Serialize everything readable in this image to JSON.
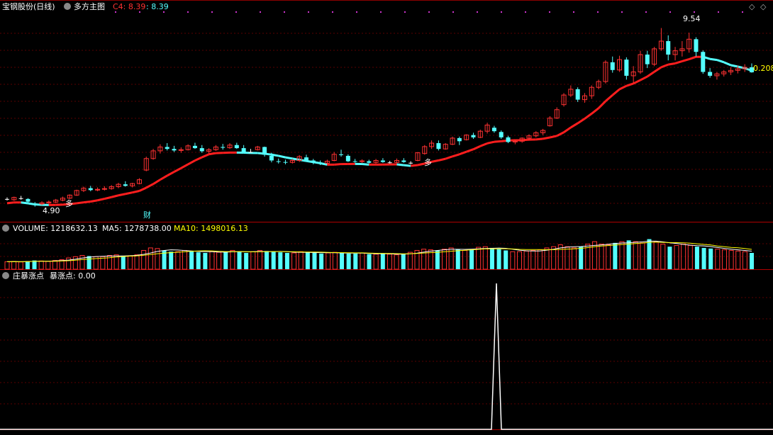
{
  "header": {
    "stock_title": "宝钢股份(日线)",
    "indicator_name": "多方主图",
    "c4_label": "C4: 8.39",
    "c4_value": ": 8.39"
  },
  "volume_panel": {
    "label": "VOLUME: 1218632.13",
    "ma5_label": "MA5: 1278738.00",
    "ma10_label": "MA10: 1498016.13"
  },
  "bottom_panel": {
    "label": "庄暴涨点",
    "value_label": "暴涨点: 0.00"
  },
  "annotations": {
    "high_price": "9.54",
    "low_price": "4.90",
    "current_value": "0.208",
    "duo_marker": "多",
    "cai_marker": "财"
  },
  "colors": {
    "up": "#ff3232",
    "down": "#54ffff",
    "flat": "#ffffff",
    "ma_red": "#ff1e1e",
    "ma_cyan": "#54ffff",
    "ma5": "#ffffff",
    "ma10": "#ffff00",
    "grid": "#8b0000"
  },
  "chart_data": [
    {
      "type": "candlestick",
      "title": "宝钢股份(日线)",
      "yrange": [
        4.6,
        9.9
      ],
      "annotations": [
        {
          "text": "9.54",
          "value": 9.54
        },
        {
          "text": "4.90",
          "value": 4.9
        }
      ],
      "ohlc": [
        [
          5.1,
          5.14,
          5.06,
          5.1
        ],
        [
          5.08,
          5.16,
          5.05,
          5.14
        ],
        [
          5.12,
          5.18,
          5.08,
          5.12
        ],
        [
          5.1,
          5.12,
          5.0,
          5.03
        ],
        [
          4.98,
          5.02,
          4.9,
          4.96
        ],
        [
          4.97,
          5.04,
          4.94,
          5.0
        ],
        [
          5.0,
          5.06,
          4.96,
          5.02
        ],
        [
          5.02,
          5.1,
          4.99,
          5.07
        ],
        [
          5.07,
          5.16,
          5.04,
          5.12
        ],
        [
          5.12,
          5.22,
          5.1,
          5.2
        ],
        [
          5.2,
          5.34,
          5.18,
          5.32
        ],
        [
          5.32,
          5.42,
          5.28,
          5.38
        ],
        [
          5.38,
          5.44,
          5.3,
          5.33
        ],
        [
          5.33,
          5.4,
          5.3,
          5.35
        ],
        [
          5.35,
          5.43,
          5.32,
          5.37
        ],
        [
          5.37,
          5.46,
          5.34,
          5.42
        ],
        [
          5.42,
          5.52,
          5.38,
          5.48
        ],
        [
          5.48,
          5.56,
          5.42,
          5.44
        ],
        [
          5.44,
          5.52,
          5.4,
          5.5
        ],
        [
          5.5,
          5.64,
          5.48,
          5.6
        ],
        [
          5.85,
          6.2,
          5.82,
          6.15
        ],
        [
          6.15,
          6.4,
          6.12,
          6.35
        ],
        [
          6.35,
          6.52,
          6.28,
          6.45
        ],
        [
          6.45,
          6.55,
          6.36,
          6.4
        ],
        [
          6.4,
          6.48,
          6.32,
          6.36
        ],
        [
          6.36,
          6.44,
          6.3,
          6.38
        ],
        [
          6.38,
          6.52,
          6.36,
          6.48
        ],
        [
          6.48,
          6.56,
          6.4,
          6.42
        ],
        [
          6.42,
          6.5,
          6.3,
          6.34
        ],
        [
          6.34,
          6.42,
          6.28,
          6.38
        ],
        [
          6.38,
          6.5,
          6.35,
          6.45
        ],
        [
          6.45,
          6.53,
          6.38,
          6.43
        ],
        [
          6.43,
          6.55,
          6.4,
          6.5
        ],
        [
          6.5,
          6.56,
          6.4,
          6.42
        ],
        [
          6.42,
          6.5,
          6.3,
          6.32
        ],
        [
          6.32,
          6.4,
          6.3,
          6.32
        ],
        [
          6.38,
          6.48,
          6.36,
          6.45
        ],
        [
          6.45,
          6.46,
          6.2,
          6.25
        ],
        [
          6.22,
          6.3,
          6.05,
          6.1
        ],
        [
          6.08,
          6.15,
          6.02,
          6.07
        ],
        [
          6.06,
          6.12,
          6.0,
          6.05
        ],
        [
          6.05,
          6.14,
          6.02,
          6.1
        ],
        [
          6.1,
          6.24,
          6.06,
          6.2
        ],
        [
          6.18,
          6.25,
          6.08,
          6.1
        ],
        [
          6.1,
          6.14,
          6.0,
          6.05
        ],
        [
          6.04,
          6.1,
          5.98,
          6.02
        ],
        [
          6.03,
          6.12,
          6.01,
          6.08
        ],
        [
          6.1,
          6.32,
          6.08,
          6.26
        ],
        [
          6.26,
          6.38,
          6.2,
          6.24
        ],
        [
          6.22,
          6.26,
          6.06,
          6.08
        ],
        [
          6.08,
          6.14,
          6.04,
          6.07
        ],
        [
          6.07,
          6.13,
          6.03,
          6.09
        ],
        [
          6.08,
          6.12,
          6.02,
          6.04
        ],
        [
          6.05,
          6.14,
          6.02,
          6.1
        ],
        [
          6.1,
          6.16,
          6.04,
          6.06
        ],
        [
          6.05,
          6.09,
          6.02,
          6.05
        ],
        [
          6.05,
          6.15,
          6.02,
          6.1
        ],
        [
          6.1,
          6.16,
          6.04,
          6.06
        ],
        [
          6.04,
          6.08,
          6.0,
          6.04
        ],
        [
          6.1,
          6.32,
          6.08,
          6.3
        ],
        [
          6.28,
          6.5,
          6.25,
          6.46
        ],
        [
          6.46,
          6.62,
          6.4,
          6.55
        ],
        [
          6.55,
          6.62,
          6.36,
          6.4
        ],
        [
          6.4,
          6.55,
          6.38,
          6.52
        ],
        [
          6.52,
          6.72,
          6.5,
          6.68
        ],
        [
          6.68,
          6.72,
          6.5,
          6.6
        ],
        [
          6.64,
          6.78,
          6.62,
          6.76
        ],
        [
          6.76,
          6.82,
          6.66,
          6.7
        ],
        [
          6.7,
          6.9,
          6.68,
          6.86
        ],
        [
          6.86,
          7.08,
          6.8,
          7.02
        ],
        [
          6.95,
          7.0,
          6.82,
          6.86
        ],
        [
          6.84,
          6.88,
          6.66,
          6.7
        ],
        [
          6.7,
          6.74,
          6.55,
          6.58
        ],
        [
          6.58,
          6.64,
          6.52,
          6.6
        ],
        [
          6.6,
          6.7,
          6.56,
          6.68
        ],
        [
          6.68,
          6.78,
          6.62,
          6.74
        ],
        [
          6.74,
          6.86,
          6.7,
          6.82
        ],
        [
          6.82,
          6.92,
          6.76,
          6.88
        ],
        [
          7.0,
          7.25,
          6.98,
          7.2
        ],
        [
          7.2,
          7.48,
          7.18,
          7.42
        ],
        [
          7.55,
          7.85,
          7.5,
          7.8
        ],
        [
          7.8,
          8.05,
          7.75,
          7.95
        ],
        [
          7.95,
          8.0,
          7.62,
          7.68
        ],
        [
          7.68,
          7.85,
          7.6,
          7.78
        ],
        [
          7.78,
          8.05,
          7.7,
          8.0
        ],
        [
          8.0,
          8.2,
          7.95,
          8.15
        ],
        [
          8.15,
          8.7,
          8.1,
          8.65
        ],
        [
          8.65,
          8.8,
          8.38,
          8.45
        ],
        [
          8.45,
          8.82,
          8.4,
          8.72
        ],
        [
          8.72,
          8.78,
          8.2,
          8.3
        ],
        [
          8.3,
          8.55,
          8.1,
          8.4
        ],
        [
          8.4,
          8.95,
          8.35,
          8.85
        ],
        [
          8.85,
          8.95,
          8.5,
          8.6
        ],
        [
          8.6,
          9.05,
          8.55,
          9.0
        ],
        [
          9.0,
          9.54,
          8.95,
          9.2
        ],
        [
          9.2,
          9.35,
          8.7,
          8.85
        ],
        [
          8.85,
          9.05,
          8.7,
          8.95
        ],
        [
          8.95,
          9.2,
          8.8,
          9.0
        ],
        [
          9.0,
          9.42,
          8.9,
          9.25
        ],
        [
          9.25,
          9.3,
          8.8,
          8.92
        ],
        [
          8.92,
          8.96,
          8.35,
          8.4
        ],
        [
          8.4,
          8.5,
          8.25,
          8.3
        ],
        [
          8.3,
          8.4,
          8.2,
          8.35
        ],
        [
          8.35,
          8.45,
          8.28,
          8.4
        ],
        [
          8.4,
          8.52,
          8.32,
          8.44
        ],
        [
          8.44,
          8.56,
          8.36,
          8.48
        ],
        [
          8.48,
          8.6,
          8.4,
          8.52
        ],
        [
          8.52,
          8.62,
          8.38,
          8.39
        ]
      ]
    },
    {
      "type": "bar",
      "title": "VOLUME",
      "values": [
        600,
        620,
        580,
        640,
        700,
        660,
        620,
        700,
        760,
        900,
        1000,
        1100,
        1050,
        1000,
        1000,
        1100,
        1150,
        1050,
        1080,
        1150,
        1500,
        1700,
        1650,
        1500,
        1400,
        1400,
        1500,
        1450,
        1350,
        1300,
        1400,
        1350,
        1400,
        1500,
        1400,
        1300,
        1400,
        1500,
        1450,
        1400,
        1350,
        1300,
        1300,
        1400,
        1350,
        1300,
        1250,
        1300,
        1350,
        1300,
        1250,
        1250,
        1300,
        1200,
        1200,
        1250,
        1200,
        1150,
        1200,
        1350,
        1500,
        1600,
        1550,
        1500,
        1600,
        1700,
        1600,
        1500,
        1600,
        1750,
        1800,
        1700,
        1600,
        1500,
        1400,
        1400,
        1450,
        1500,
        1550,
        1700,
        1800,
        1950,
        1800,
        1700,
        1800,
        2000,
        2200,
        2000,
        1950,
        2100,
        2200,
        2300,
        2200,
        2100,
        2400,
        2200,
        2000,
        1800,
        1900,
        2000,
        1900,
        1800,
        1700,
        1650,
        1600,
        1550,
        1500,
        1450,
        1400,
        1300
      ],
      "ma5": 1278738.0,
      "ma10": 1498016.13,
      "latest": 1218632.13
    },
    {
      "type": "line",
      "title": "庄暴涨点",
      "yrange": [
        0,
        1
      ],
      "series": [
        {
          "name": "暴涨点",
          "spike_index": 71,
          "latest": 0.0
        }
      ]
    }
  ]
}
